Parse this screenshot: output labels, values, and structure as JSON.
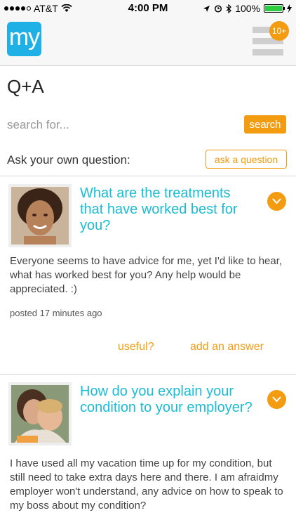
{
  "status_bar": {
    "carrier": "AT&T",
    "time": "4:00 PM",
    "battery": "100%"
  },
  "header": {
    "logo_text": "my",
    "menu_badge": "10+"
  },
  "page": {
    "title": "Q+A"
  },
  "search": {
    "placeholder": "search for...",
    "button_label": "search"
  },
  "ask": {
    "label": "Ask your own question:",
    "button_label": "ask a question"
  },
  "questions": [
    {
      "title": "What are the treatments that have worked best for you?",
      "body": "Everyone seems to have advice for me, yet I'd like to hear, what has worked best for you? Any help would be appreciated. :)",
      "posted": "posted 17 minutes ago",
      "useful_label": "useful?",
      "answer_label": "add an answer"
    },
    {
      "title": "How do you explain your condition to your employer?",
      "body": "I have used all my vacation time up for my condition, but still need to take extra days here and there.  I am afraidmy employer won't understand, any advice on how to speak to my boss about my condition?"
    }
  ],
  "colors": {
    "accent": "#f39c12",
    "title": "#1bbcd4",
    "logo": "#1fb1e6"
  }
}
